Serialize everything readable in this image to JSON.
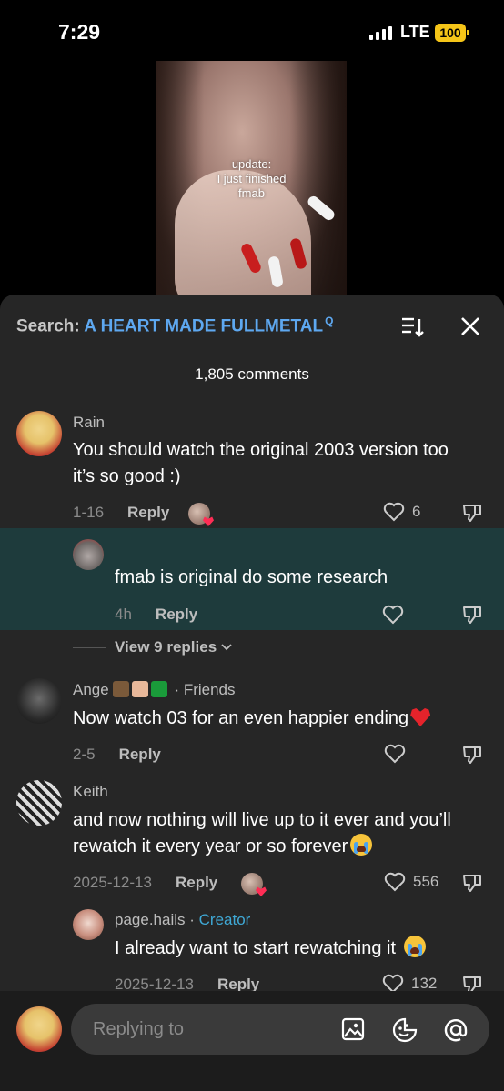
{
  "status_bar": {
    "time": "7:29",
    "network": "LTE",
    "battery": "100"
  },
  "video": {
    "caption_lines": [
      "update:",
      "I just finished",
      "fmab"
    ]
  },
  "search": {
    "label": "Search:",
    "term": "A HEART MADE FULLMETAL",
    "term_suffix": "Q"
  },
  "comments_count": "1,805 comments",
  "comments": [
    {
      "user": "Rain",
      "text": "You should watch the original 2003 version too it’s so good :)",
      "date": "1-16",
      "reply_label": "Reply",
      "likes": "6"
    },
    {
      "user": "",
      "text": "fmab is original do some research",
      "date": "4h",
      "reply_label": "Reply",
      "likes": ""
    },
    {
      "user": "Ange",
      "user_suffix": "· Friends",
      "text": "Now watch 03 for an even happier ending",
      "date": "2-5",
      "reply_label": "Reply",
      "likes": ""
    },
    {
      "user": "Keith",
      "text": "and now nothing will live up to it ever and you’ll rewatch it every year or so forever",
      "date": "2025-12-13",
      "reply_label": "Reply",
      "likes": "556"
    },
    {
      "user": "page.hails",
      "user_suffix": "·",
      "creator_label": "Creator",
      "text": "I already want to start rewatching it",
      "date": "2025-12-13",
      "reply_label": "Reply",
      "likes": "132"
    }
  ],
  "view_replies": "View 9 replies",
  "reply_input": {
    "placeholder": "Replying to"
  },
  "colors": {
    "accent": "#5ea8f0",
    "creator": "#3fa9d6",
    "highlight": "#1e3b3c",
    "sheet": "#262626"
  },
  "icons": [
    "sort-icon",
    "close-icon",
    "heart-outline-icon",
    "dislike-icon",
    "image-icon",
    "sticker-icon",
    "at-icon",
    "chevron-down-icon"
  ]
}
